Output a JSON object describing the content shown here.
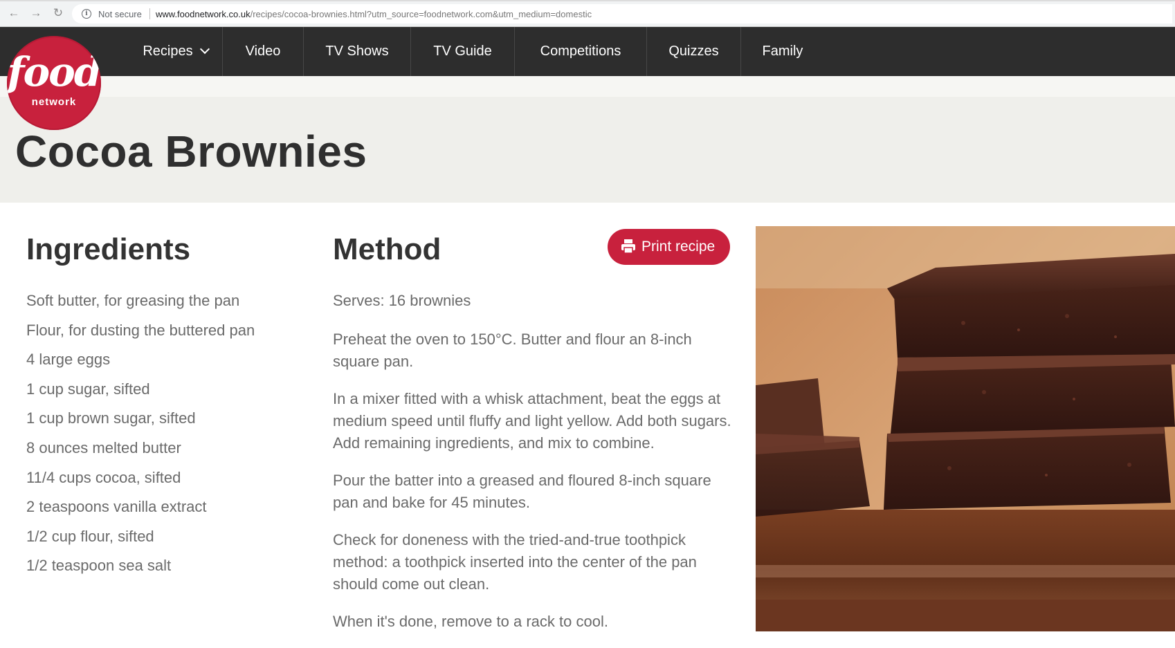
{
  "browser": {
    "security_label": "Not secure",
    "url_host": "www.foodnetwork.co.uk",
    "url_path": "/recipes/cocoa-brownies.html?utm_source=foodnetwork.com&utm_medium=domestic"
  },
  "logo": {
    "word": "food",
    "sub": "network"
  },
  "nav": {
    "items": [
      {
        "label": "Recipes"
      },
      {
        "label": "Video"
      },
      {
        "label": "TV Shows"
      },
      {
        "label": "TV Guide"
      },
      {
        "label": "Competitions"
      },
      {
        "label": "Quizzes"
      },
      {
        "label": "Family"
      }
    ]
  },
  "recipe": {
    "title": "Cocoa Brownies",
    "ingredients_heading": "Ingredients",
    "method_heading": "Method",
    "print_label": "Print recipe",
    "ingredients": [
      "Soft butter, for greasing the pan",
      "Flour, for dusting the buttered pan",
      "4 large eggs",
      "1 cup sugar, sifted",
      "1 cup brown sugar, sifted",
      "8 ounces melted butter",
      "11/4 cups cocoa, sifted",
      "2 teaspoons vanilla extract",
      "1/2 cup flour, sifted",
      "1/2 teaspoon sea salt"
    ],
    "serves": "Serves: 16 brownies",
    "steps": [
      "Preheat the oven to 150°C. Butter and flour an 8-inch square pan.",
      "In a mixer fitted with a whisk attachment, beat the eggs at medium speed until fluffy and light yellow. Add both sugars. Add remaining ingredients, and mix to combine.",
      "Pour the batter into a greased and floured 8-inch square pan and bake for 45 minutes.",
      "Check for doneness with the tried-and-true toothpick method: a toothpick inserted into the center of the pan should come out clean.",
      "When it's done, remove to a rack to cool."
    ]
  },
  "colors": {
    "brand_red": "#c8213d",
    "nav_bg": "#2d2d2d",
    "title_band": "#efefeb"
  }
}
